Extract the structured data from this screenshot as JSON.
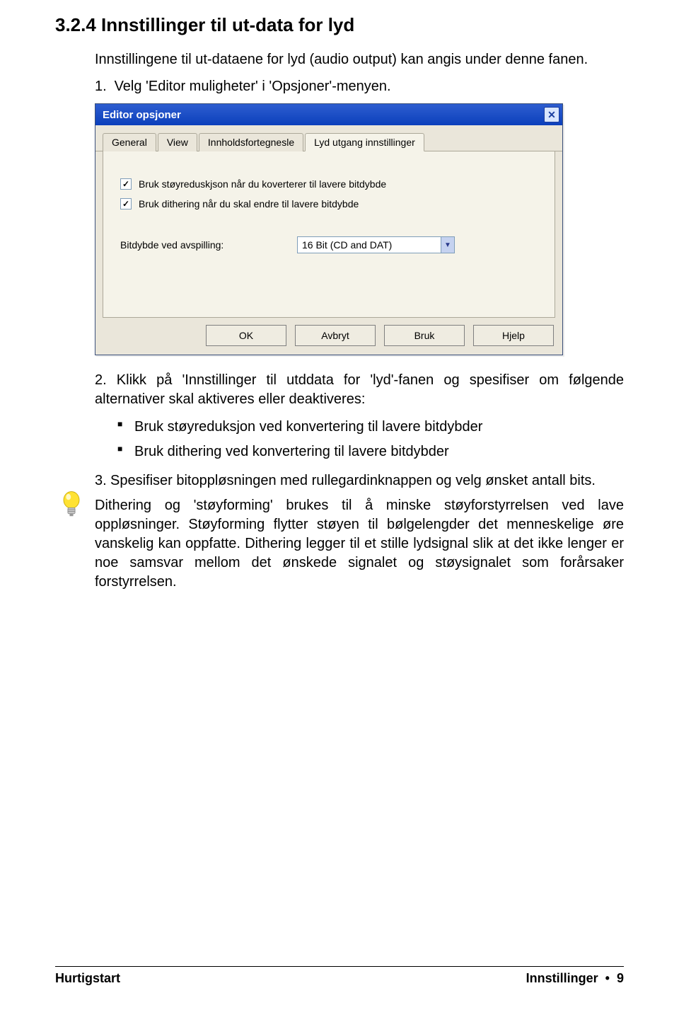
{
  "heading": "3.2.4   Innstillinger til ut-data for lyd",
  "intro": "Innstillingene til ut-dataene for lyd (audio output) kan angis under denne fanen.",
  "step1": {
    "num": "1.",
    "text": "Velg 'Editor muligheter' i 'Opsjoner'-menyen."
  },
  "dialog": {
    "title": "Editor opsjoner",
    "tabs": [
      "General",
      "View",
      "Innholdsfortegnesle",
      "Lyd utgang innstillinger"
    ],
    "active_tab": 3,
    "checkbox1": "Bruk støyreduskjson når du koverterer til lavere bitdybde",
    "checkbox2": "Bruk dithering når du skal endre til lavere bitdybde",
    "bitdepth_label": "Bitdybde ved avspilling:",
    "bitdepth_value": "16 Bit (CD and DAT)",
    "buttons": [
      "OK",
      "Avbryt",
      "Bruk",
      "Hjelp"
    ]
  },
  "step2": {
    "num": "2.",
    "text": "Klikk på 'Innstillinger til utddata for 'lyd'-fanen og spesifiser om følgende alternativer skal aktiveres eller deaktiveres:"
  },
  "bullets": [
    "Bruk støyreduksjon ved konvertering til lavere bitdybder",
    "Bruk dithering ved konvertering til lavere bitdybder"
  ],
  "step3": {
    "num": "3.",
    "text": "Spesifiser bitoppløsningen med rullegardinknappen og velg ønsket antall bits."
  },
  "tip": "Dithering og 'støyforming' brukes til å minske støyforstyrrelsen ved lave oppløsninger. Støyforming flytter støyen til bølgelengder det menneskelige øre vanskelig kan oppfatte. Dithering legger til et stille lydsignal slik at det ikke lenger er noe samsvar mellom det ønskede signalet og støysignalet som forårsaker forstyrrelsen.",
  "footer": {
    "left": "Hurtigstart",
    "right_label": "Innstillinger",
    "right_page": "9"
  }
}
